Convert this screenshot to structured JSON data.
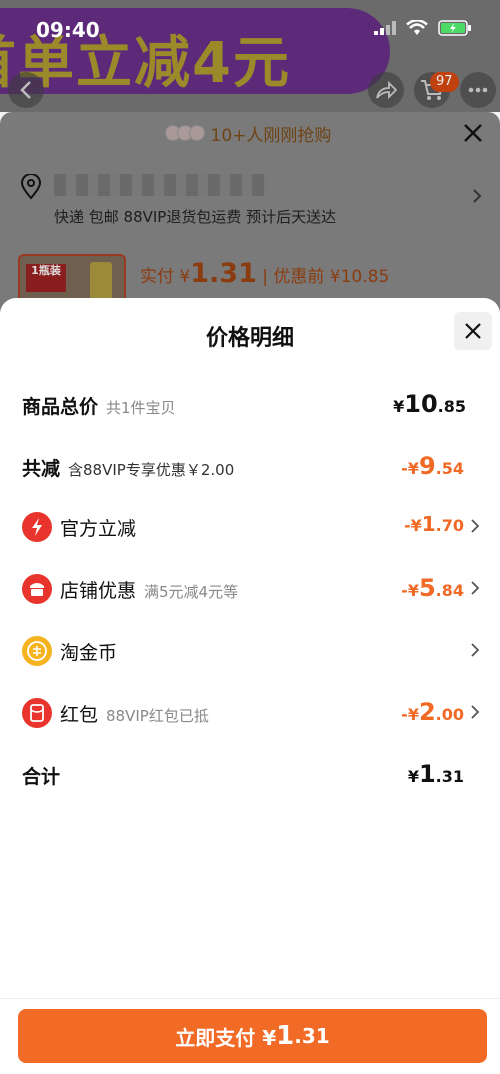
{
  "status": {
    "time": "09:40"
  },
  "background": {
    "banner_text": "首单立减4元",
    "cart_count": "97",
    "grab_text": "10+人刚刚抢购",
    "delivery_text": "快递 包邮 88VIP退货包运费 预计后天送达",
    "price_prefix": "实付 ¥",
    "price_value": "1.31",
    "price_before": "| 优惠前 ¥10.85",
    "thumb_mark": "1瓶装"
  },
  "modal": {
    "title": "价格明细",
    "rows": [
      {
        "label": "商品总价",
        "sub": "共1件宝贝",
        "currency": "¥",
        "amount_int": "10",
        "amount_dec": ".85",
        "icon": "",
        "color": "black"
      },
      {
        "label": "共减",
        "sub": "含88VIP专享优惠￥2.00",
        "currency": "-¥",
        "amount_int": "9",
        "amount_dec": ".54",
        "icon": "",
        "color": "orange"
      },
      {
        "label": "官方立减",
        "sub": "",
        "currency": "-¥",
        "amount_int": "1",
        "amount_dec": ".70",
        "icon": "lightning-icon",
        "color": "orange"
      },
      {
        "label": "店铺优惠",
        "sub": "满5元减4元等",
        "currency": "-¥",
        "amount_int": "5",
        "amount_dec": ".84",
        "icon": "shop-icon",
        "color": "orange"
      },
      {
        "label": "淘金币",
        "sub": "",
        "currency": "",
        "amount_int": "",
        "amount_dec": "",
        "icon": "coin-icon",
        "color": "black"
      },
      {
        "label": "红包",
        "sub": "88VIP红包已抵",
        "currency": "-¥",
        "amount_int": "2",
        "amount_dec": ".00",
        "icon": "red-packet-icon",
        "color": "orange"
      },
      {
        "label": "合计",
        "sub": "",
        "currency": "¥",
        "amount_int": "1",
        "amount_dec": ".31",
        "icon": "",
        "color": "black"
      }
    ]
  },
  "pay_button": {
    "label": "立即支付 ¥",
    "amount_int": "1",
    "amount_dec": ".31"
  },
  "colors": {
    "accent": "#f26b26",
    "discount": "#f06a25",
    "icon_red": "#e8342c",
    "coin": "#f5b31f"
  }
}
